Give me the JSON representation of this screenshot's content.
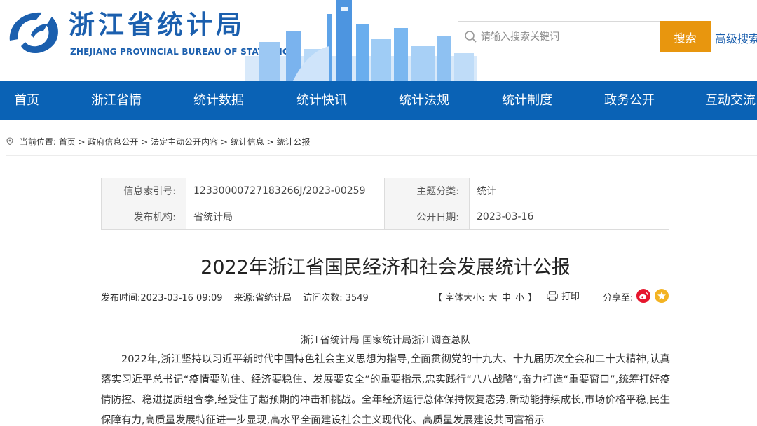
{
  "header": {
    "title": "浙江省统计局",
    "subtitle": "ZHEJIANG PROVINCIAL BUREAU OF STATISTICS",
    "brand_color": "#1b5fae"
  },
  "search": {
    "placeholder": "请输入搜索关键词",
    "button_label": "搜索",
    "advanced_label": "高级搜索"
  },
  "nav": {
    "color": "#0a62b5",
    "items": [
      "首页",
      "浙江省情",
      "统计数据",
      "统计快讯",
      "统计法规",
      "统计制度",
      "政务公开",
      "互动交流"
    ]
  },
  "breadcrumb": {
    "prefix": "当前位置:",
    "path": "首页 > 政府信息公开 > 法定主动公开内容 > 统计信息 > 统计公报"
  },
  "info": {
    "index_label": "信息索引号:",
    "index_value": "12330000727183266J/2023-00259",
    "topic_label": "主题分类:",
    "topic_value": "统计",
    "publisher_label": "发布机构:",
    "publisher_value": "省统计局",
    "date_label": "公开日期:",
    "date_value": "2023-03-16"
  },
  "article": {
    "title": "2022年浙江省国民经济和社会发展统计公报",
    "publish_time": "发布时间:2023-03-16 09:09",
    "source": "来源:省统计局",
    "views": "访问次数: 3549",
    "font_size_prefix": "【 字体大小:",
    "font_large": "大",
    "font_medium": "中",
    "font_small": "小",
    "font_size_suffix": "】",
    "print_label": "打印",
    "share_label": "分享至:",
    "author": "浙江省统计局  国家统计局浙江调查总队",
    "body": "2022年,浙江坚持以习近平新时代中国特色社会主义思想为指导,全面贯彻党的十九大、十九届历次全会和二十大精神,认真落实习近平总书记“疫情要防住、经济要稳住、发展要安全”的重要指示,忠实践行“八八战略”,奋力打造“重要窗口”,统筹打好疫情防控、稳进提质组合拳,经受住了超预期的冲击和挑战。全年经济运行总体保持恢复态势,新动能持续成长,市场价格平稳,民生保障有力,高质量发展特征进一步显现,高水平全面建设社会主义现代化、高质量发展建设共同富裕示"
  }
}
